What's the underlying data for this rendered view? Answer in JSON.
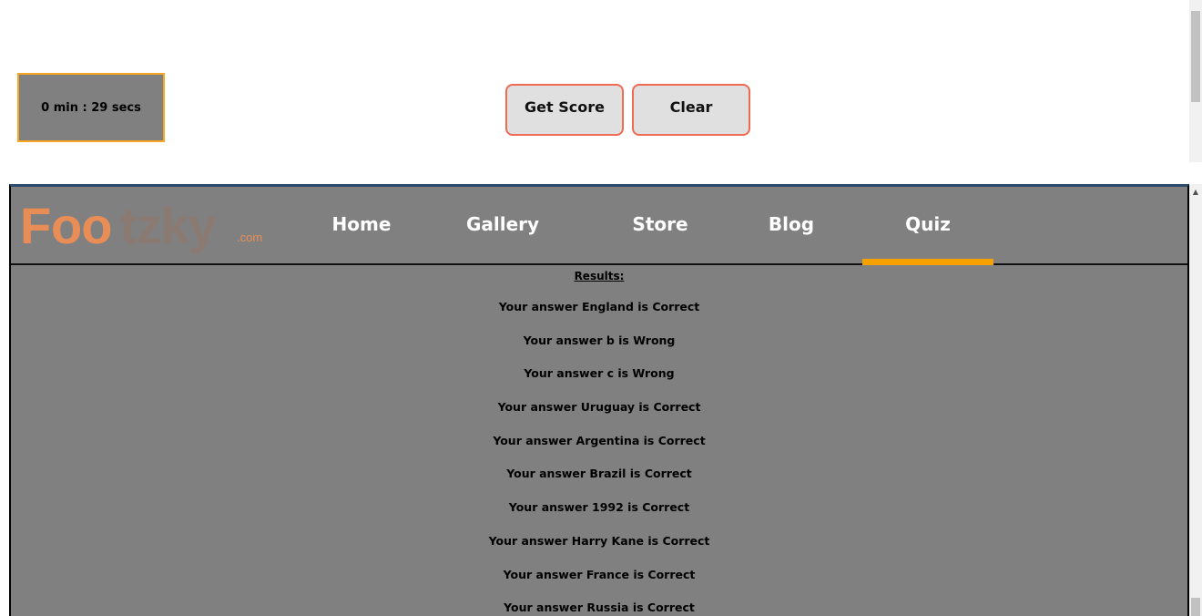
{
  "timer": {
    "text": "0 min : 29 secs"
  },
  "buttons": {
    "score_label": "Get Score",
    "clear_label": "Clear"
  },
  "logo": {
    "part1": "F",
    "part2": "oo",
    "part3": "tzky",
    "suffix": ".com"
  },
  "nav": {
    "items": [
      {
        "label": "Home"
      },
      {
        "label": "Gallery"
      },
      {
        "label": "Store"
      },
      {
        "label": "Blog"
      },
      {
        "label": "Quiz",
        "active": true
      }
    ]
  },
  "results": {
    "heading": "Results:",
    "rows": [
      "Your answer England is Correct",
      "Your answer b is Wrong",
      "Your answer c is Wrong",
      "Your answer Uruguay is Correct",
      "Your answer Argentina is Correct",
      "Your answer Brazil is Correct",
      "Your answer 1992 is Correct",
      "Your answer Harry Kane is Correct",
      "Your answer France is Correct",
      "Your answer Russia is Correct"
    ]
  },
  "colors": {
    "accent": "#f5a100",
    "button_border": "#ee6a52",
    "panel": "#808080",
    "logo": "#e98d57"
  }
}
